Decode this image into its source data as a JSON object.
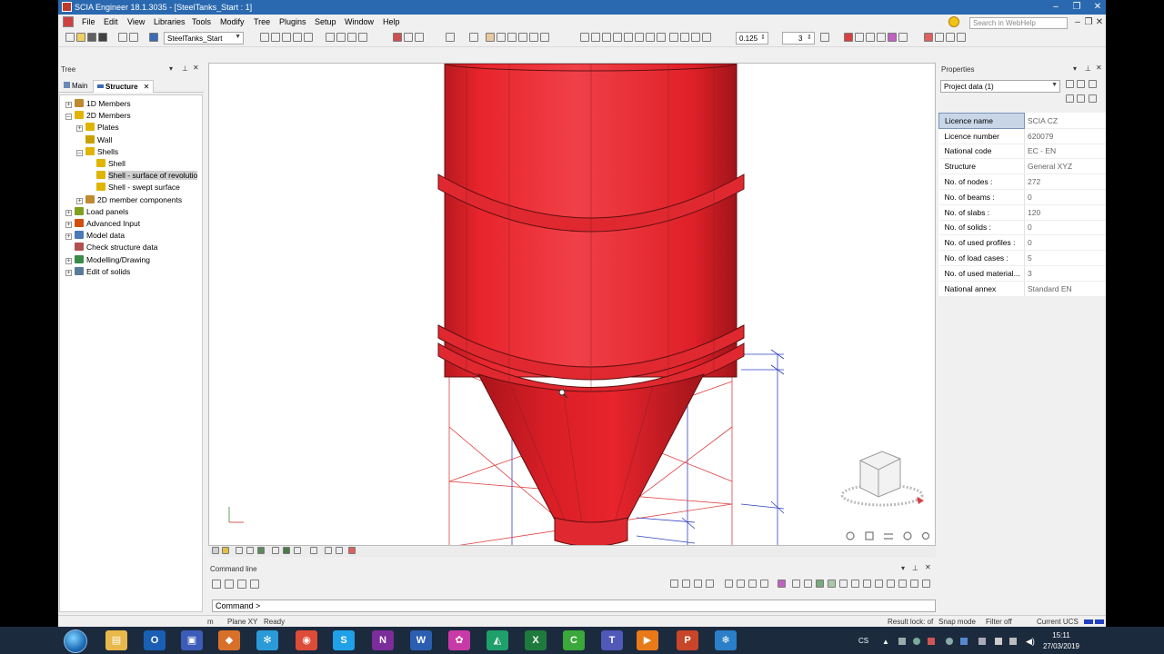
{
  "window": {
    "title": "SCIA Engineer 18.1.3035 - [SteelTanks_Start : 1]",
    "buttons": [
      "–",
      "❐",
      "✕"
    ],
    "inner_buttons": [
      "–",
      "❐",
      "✕"
    ]
  },
  "menu": {
    "items": [
      "File",
      "Edit",
      "View",
      "Libraries",
      "Tools",
      "Modify",
      "Tree",
      "Plugins",
      "Setup",
      "Window",
      "Help"
    ],
    "search_placeholder": "Search in WebHelp"
  },
  "toolbar": {
    "project_combo": "SteelTanks_Start",
    "scale_value": "0.125",
    "count_value": "3"
  },
  "tree": {
    "title": "Tree",
    "tabs": [
      "Main",
      "Structure"
    ],
    "active_tab": "Structure",
    "nodes": [
      {
        "label": "1D Members",
        "level": 0,
        "expander": "+",
        "icon_color": "#c08a30"
      },
      {
        "label": "2D Members",
        "level": 0,
        "expander": "–",
        "icon_color": "#e0b400"
      },
      {
        "label": "Plates",
        "level": 1,
        "expander": "+",
        "icon_color": "#e0b400"
      },
      {
        "label": "Wall",
        "level": 1,
        "expander": "",
        "icon_color": "#c8a000"
      },
      {
        "label": "Shells",
        "level": 1,
        "expander": "–",
        "icon_color": "#e0b400"
      },
      {
        "label": "Shell",
        "level": 2,
        "expander": "",
        "icon_color": "#e0b400"
      },
      {
        "label": "Shell - surface of revolutio",
        "level": 2,
        "expander": "",
        "icon_color": "#e0b400",
        "selected": true
      },
      {
        "label": "Shell - swept surface",
        "level": 2,
        "expander": "",
        "icon_color": "#e0b400"
      },
      {
        "label": "2D member components",
        "level": 1,
        "expander": "+",
        "icon_color": "#c08a30"
      },
      {
        "label": "Load panels",
        "level": 0,
        "expander": "+",
        "icon_color": "#7fa020"
      },
      {
        "label": "Advanced Input",
        "level": 0,
        "expander": "+",
        "icon_color": "#d05010"
      },
      {
        "label": "Model data",
        "level": 0,
        "expander": "+",
        "icon_color": "#4a7ab8"
      },
      {
        "label": "Check structure data",
        "level": 0,
        "expander": "",
        "icon_color": "#b05050"
      },
      {
        "label": "Modelling/Drawing",
        "level": 0,
        "expander": "+",
        "icon_color": "#3a8a4a"
      },
      {
        "label": "Edit of solids",
        "level": 0,
        "expander": "+",
        "icon_color": "#5a7a9a"
      }
    ]
  },
  "properties": {
    "title": "Properties",
    "combo": "Project data (1)",
    "rows": [
      {
        "key": "Licence name",
        "value": "SCIA CZ"
      },
      {
        "key": "Licence number",
        "value": "620079"
      },
      {
        "key": "National code",
        "value": "EC - EN"
      },
      {
        "key": "Structure",
        "value": "General XYZ"
      },
      {
        "key": "No. of nodes :",
        "value": "272"
      },
      {
        "key": "No. of beams :",
        "value": "0"
      },
      {
        "key": "No. of slabs :",
        "value": "120"
      },
      {
        "key": "No. of solids :",
        "value": "0"
      },
      {
        "key": "No. of used profiles :",
        "value": "0"
      },
      {
        "key": "No. of load cases :",
        "value": "5"
      },
      {
        "key": "No. of used material...",
        "value": "3"
      },
      {
        "key": "National annex",
        "value": "Standard EN"
      }
    ]
  },
  "command_line": {
    "title": "Command line",
    "prompt": "Command >"
  },
  "status_bar": {
    "unit": "m",
    "plane": "Plane XY",
    "status": "Ready",
    "result_lock": "Result lock: of",
    "snap": "Snap mode",
    "filter": "Filter off",
    "ucs": "Current UCS"
  },
  "colors": {
    "tank_red": "#e8242c",
    "frame_red": "#e04040",
    "frame_blue": "#3040c0",
    "title_bar": "#2a69b0",
    "taskbar": "#1c2a3e"
  },
  "taskbar": {
    "lang": "CS",
    "time": "15:11",
    "date": "27/03/2019",
    "apps": [
      {
        "name": "file-explorer",
        "glyph": "▤",
        "color": "#e8b84a"
      },
      {
        "name": "outlook",
        "glyph": "O",
        "color": "#1a5fb4"
      },
      {
        "name": "save-disk",
        "glyph": "▣",
        "color": "#3b5cb8"
      },
      {
        "name": "scia",
        "glyph": "◆",
        "color": "#d8702a"
      },
      {
        "name": "snowflake-app",
        "glyph": "✻",
        "color": "#2a9ad8"
      },
      {
        "name": "chrome",
        "glyph": "◉",
        "color": "#dd4b39"
      },
      {
        "name": "skype",
        "glyph": "S",
        "color": "#1fa0e8"
      },
      {
        "name": "onenote",
        "glyph": "N",
        "color": "#7b2d9a"
      },
      {
        "name": "word",
        "glyph": "W",
        "color": "#2b5eb0"
      },
      {
        "name": "atom-app",
        "glyph": "✿",
        "color": "#c83aa8"
      },
      {
        "name": "scia-green",
        "glyph": "◭",
        "color": "#1f9f6a"
      },
      {
        "name": "excel",
        "glyph": "X",
        "color": "#1f7a3e"
      },
      {
        "name": "camtasia",
        "glyph": "C",
        "color": "#3aa83a"
      },
      {
        "name": "teams",
        "glyph": "T",
        "color": "#5058b8"
      },
      {
        "name": "recorder",
        "glyph": "▶",
        "color": "#e87a1a"
      },
      {
        "name": "powerpoint",
        "glyph": "P",
        "color": "#c8452a"
      },
      {
        "name": "snow-app",
        "glyph": "❄",
        "color": "#2a7fc8"
      }
    ]
  }
}
